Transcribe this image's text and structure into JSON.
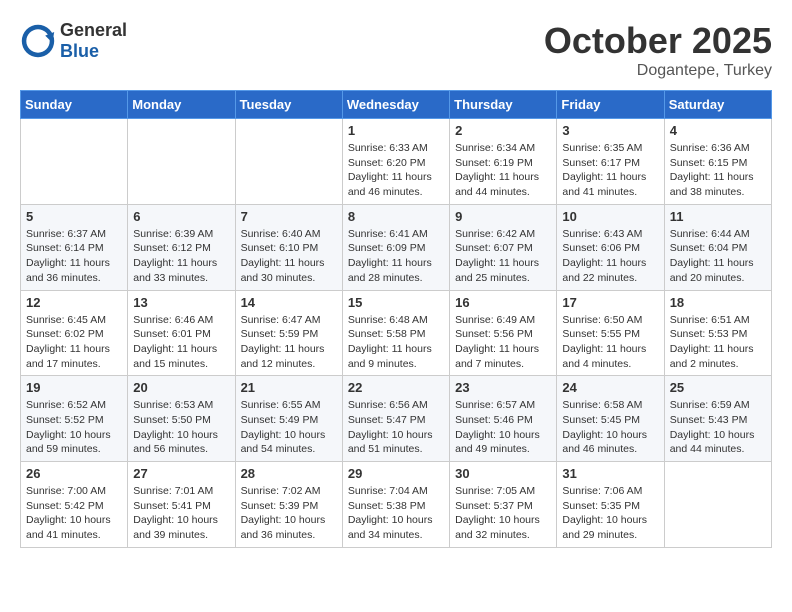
{
  "header": {
    "logo_general": "General",
    "logo_blue": "Blue",
    "month": "October 2025",
    "location": "Dogantepe, Turkey"
  },
  "days_of_week": [
    "Sunday",
    "Monday",
    "Tuesday",
    "Wednesday",
    "Thursday",
    "Friday",
    "Saturday"
  ],
  "weeks": [
    [
      {
        "day": "",
        "info": ""
      },
      {
        "day": "",
        "info": ""
      },
      {
        "day": "",
        "info": ""
      },
      {
        "day": "1",
        "info": "Sunrise: 6:33 AM\nSunset: 6:20 PM\nDaylight: 11 hours and 46 minutes."
      },
      {
        "day": "2",
        "info": "Sunrise: 6:34 AM\nSunset: 6:19 PM\nDaylight: 11 hours and 44 minutes."
      },
      {
        "day": "3",
        "info": "Sunrise: 6:35 AM\nSunset: 6:17 PM\nDaylight: 11 hours and 41 minutes."
      },
      {
        "day": "4",
        "info": "Sunrise: 6:36 AM\nSunset: 6:15 PM\nDaylight: 11 hours and 38 minutes."
      }
    ],
    [
      {
        "day": "5",
        "info": "Sunrise: 6:37 AM\nSunset: 6:14 PM\nDaylight: 11 hours and 36 minutes."
      },
      {
        "day": "6",
        "info": "Sunrise: 6:39 AM\nSunset: 6:12 PM\nDaylight: 11 hours and 33 minutes."
      },
      {
        "day": "7",
        "info": "Sunrise: 6:40 AM\nSunset: 6:10 PM\nDaylight: 11 hours and 30 minutes."
      },
      {
        "day": "8",
        "info": "Sunrise: 6:41 AM\nSunset: 6:09 PM\nDaylight: 11 hours and 28 minutes."
      },
      {
        "day": "9",
        "info": "Sunrise: 6:42 AM\nSunset: 6:07 PM\nDaylight: 11 hours and 25 minutes."
      },
      {
        "day": "10",
        "info": "Sunrise: 6:43 AM\nSunset: 6:06 PM\nDaylight: 11 hours and 22 minutes."
      },
      {
        "day": "11",
        "info": "Sunrise: 6:44 AM\nSunset: 6:04 PM\nDaylight: 11 hours and 20 minutes."
      }
    ],
    [
      {
        "day": "12",
        "info": "Sunrise: 6:45 AM\nSunset: 6:02 PM\nDaylight: 11 hours and 17 minutes."
      },
      {
        "day": "13",
        "info": "Sunrise: 6:46 AM\nSunset: 6:01 PM\nDaylight: 11 hours and 15 minutes."
      },
      {
        "day": "14",
        "info": "Sunrise: 6:47 AM\nSunset: 5:59 PM\nDaylight: 11 hours and 12 minutes."
      },
      {
        "day": "15",
        "info": "Sunrise: 6:48 AM\nSunset: 5:58 PM\nDaylight: 11 hours and 9 minutes."
      },
      {
        "day": "16",
        "info": "Sunrise: 6:49 AM\nSunset: 5:56 PM\nDaylight: 11 hours and 7 minutes."
      },
      {
        "day": "17",
        "info": "Sunrise: 6:50 AM\nSunset: 5:55 PM\nDaylight: 11 hours and 4 minutes."
      },
      {
        "day": "18",
        "info": "Sunrise: 6:51 AM\nSunset: 5:53 PM\nDaylight: 11 hours and 2 minutes."
      }
    ],
    [
      {
        "day": "19",
        "info": "Sunrise: 6:52 AM\nSunset: 5:52 PM\nDaylight: 10 hours and 59 minutes."
      },
      {
        "day": "20",
        "info": "Sunrise: 6:53 AM\nSunset: 5:50 PM\nDaylight: 10 hours and 56 minutes."
      },
      {
        "day": "21",
        "info": "Sunrise: 6:55 AM\nSunset: 5:49 PM\nDaylight: 10 hours and 54 minutes."
      },
      {
        "day": "22",
        "info": "Sunrise: 6:56 AM\nSunset: 5:47 PM\nDaylight: 10 hours and 51 minutes."
      },
      {
        "day": "23",
        "info": "Sunrise: 6:57 AM\nSunset: 5:46 PM\nDaylight: 10 hours and 49 minutes."
      },
      {
        "day": "24",
        "info": "Sunrise: 6:58 AM\nSunset: 5:45 PM\nDaylight: 10 hours and 46 minutes."
      },
      {
        "day": "25",
        "info": "Sunrise: 6:59 AM\nSunset: 5:43 PM\nDaylight: 10 hours and 44 minutes."
      }
    ],
    [
      {
        "day": "26",
        "info": "Sunrise: 7:00 AM\nSunset: 5:42 PM\nDaylight: 10 hours and 41 minutes."
      },
      {
        "day": "27",
        "info": "Sunrise: 7:01 AM\nSunset: 5:41 PM\nDaylight: 10 hours and 39 minutes."
      },
      {
        "day": "28",
        "info": "Sunrise: 7:02 AM\nSunset: 5:39 PM\nDaylight: 10 hours and 36 minutes."
      },
      {
        "day": "29",
        "info": "Sunrise: 7:04 AM\nSunset: 5:38 PM\nDaylight: 10 hours and 34 minutes."
      },
      {
        "day": "30",
        "info": "Sunrise: 7:05 AM\nSunset: 5:37 PM\nDaylight: 10 hours and 32 minutes."
      },
      {
        "day": "31",
        "info": "Sunrise: 7:06 AM\nSunset: 5:35 PM\nDaylight: 10 hours and 29 minutes."
      },
      {
        "day": "",
        "info": ""
      }
    ]
  ]
}
